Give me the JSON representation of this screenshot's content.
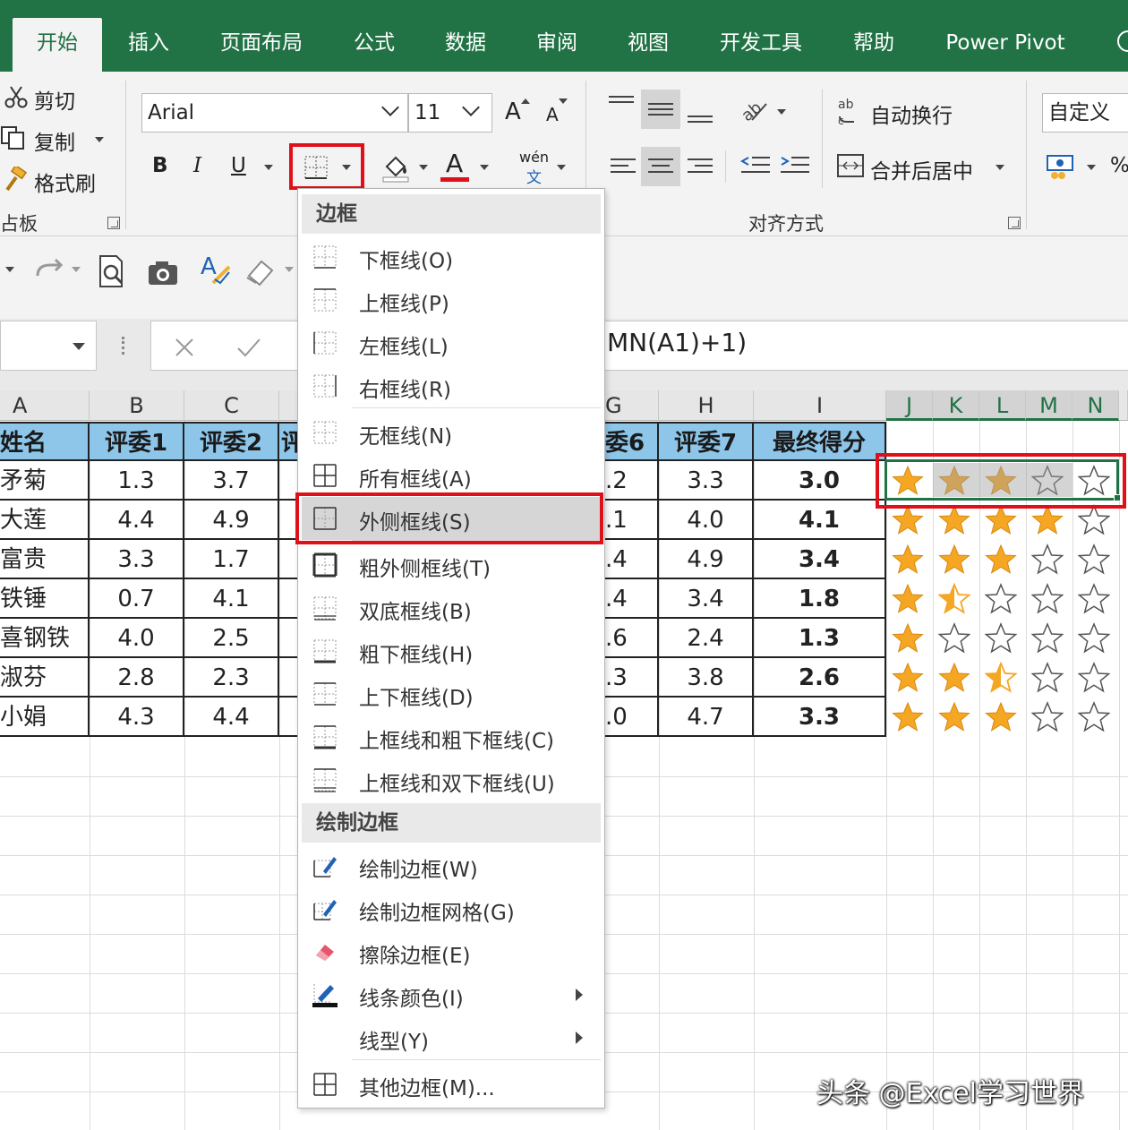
{
  "tabs": [
    {
      "label": "开始",
      "active": true
    },
    {
      "label": "插入"
    },
    {
      "label": "页面布局"
    },
    {
      "label": "公式"
    },
    {
      "label": "数据"
    },
    {
      "label": "审阅"
    },
    {
      "label": "视图"
    },
    {
      "label": "开发工具"
    },
    {
      "label": "帮助"
    },
    {
      "label": "Power Pivot"
    }
  ],
  "clipboard": {
    "cut": "剪切",
    "copy": "复制",
    "format_painter": "格式刷",
    "group_label": "占板"
  },
  "font": {
    "name": "Arial",
    "size": "11",
    "bold": "B",
    "italic": "I",
    "underline": "U",
    "grow": "A",
    "shrink": "A",
    "color_glyph": "A",
    "phonetic_top": "wén",
    "phonetic_bottom": "文"
  },
  "alignment": {
    "wrap_text": "自动换行",
    "merge_center": "合并后居中",
    "group_label": "对齐方式"
  },
  "number": {
    "format": "自定义",
    "percent": "%"
  },
  "formula_bar": {
    "content": "MN(A1)+1)"
  },
  "columns": [
    "A",
    "B",
    "C",
    "G",
    "H",
    "I",
    "J",
    "K",
    "L",
    "M",
    "N"
  ],
  "table": {
    "headers": [
      "姓名",
      "评委1",
      "评委2",
      "评",
      "委6",
      "评委7",
      "最终得分"
    ],
    "rows": [
      {
        "name": "矛菊",
        "b": "1.3",
        "c": "3.7",
        "g": ".2",
        "h": "3.3",
        "score": "3.0"
      },
      {
        "name": "大莲",
        "b": "4.4",
        "c": "4.9",
        "g": ".1",
        "h": "4.0",
        "score": "4.1"
      },
      {
        "name": "富贵",
        "b": "3.3",
        "c": "1.7",
        "g": ".4",
        "h": "4.9",
        "score": "3.4"
      },
      {
        "name": "铁锤",
        "b": "0.7",
        "c": "4.1",
        "g": ".4",
        "h": "3.4",
        "score": "1.8"
      },
      {
        "name": "喜钢铁",
        "b": "4.0",
        "c": "2.5",
        "g": ".6",
        "h": "2.4",
        "score": "1.3"
      },
      {
        "name": "淑芬",
        "b": "2.8",
        "c": "2.3",
        "g": ".3",
        "h": "3.8",
        "score": "2.6"
      },
      {
        "name": "小娟",
        "b": "4.3",
        "c": "4.4",
        "g": ".0",
        "h": "4.7",
        "score": "3.3"
      }
    ]
  },
  "ratings": [
    [
      "full",
      "full",
      "full",
      "empty",
      "empty"
    ],
    [
      "full",
      "full",
      "full",
      "full",
      "empty"
    ],
    [
      "full",
      "full",
      "full",
      "empty",
      "empty"
    ],
    [
      "full",
      "half",
      "empty",
      "empty",
      "empty"
    ],
    [
      "full",
      "empty",
      "empty",
      "empty",
      "empty"
    ],
    [
      "full",
      "full",
      "half",
      "empty",
      "empty"
    ],
    [
      "full",
      "full",
      "full",
      "empty",
      "empty"
    ]
  ],
  "border_menu": {
    "section_borders": "边框",
    "section_draw": "绘制边框",
    "items": [
      {
        "label": "下框线(O)",
        "icon": "bottom-border-icon"
      },
      {
        "label": "上框线(P)",
        "icon": "top-border-icon"
      },
      {
        "label": "左框线(L)",
        "icon": "left-border-icon"
      },
      {
        "label": "右框线(R)",
        "icon": "right-border-icon"
      },
      {
        "label": "无框线(N)",
        "icon": "no-border-icon"
      },
      {
        "label": "所有框线(A)",
        "icon": "all-borders-icon"
      },
      {
        "label": "外侧框线(S)",
        "icon": "outside-borders-icon"
      },
      {
        "label": "粗外侧框线(T)",
        "icon": "thick-outside-border-icon"
      },
      {
        "label": "双底框线(B)",
        "icon": "double-bottom-border-icon"
      },
      {
        "label": "粗下框线(H)",
        "icon": "thick-bottom-border-icon"
      },
      {
        "label": "上下框线(D)",
        "icon": "top-bottom-border-icon"
      },
      {
        "label": "上框线和粗下框线(C)",
        "icon": "top-thick-bottom-border-icon"
      },
      {
        "label": "上框线和双下框线(U)",
        "icon": "top-double-bottom-border-icon"
      }
    ],
    "draw_items": [
      {
        "label": "绘制边框(W)",
        "icon": "draw-border-icon"
      },
      {
        "label": "绘制边框网格(G)",
        "icon": "draw-border-grid-icon"
      },
      {
        "label": "擦除边框(E)",
        "icon": "eraser-icon"
      },
      {
        "label": "线条颜色(I)",
        "icon": "line-color-icon"
      },
      {
        "label": "线型(Y)",
        "icon": "line-style-icon"
      },
      {
        "label": "其他边框(M)...",
        "icon": "more-borders-icon"
      }
    ]
  },
  "colors": {
    "accent": "#217346",
    "highlight": "#e0101a",
    "header_fill": "#8ec6ea",
    "star": "#f5a623"
  },
  "watermark": "头条 @Excel学习世界"
}
